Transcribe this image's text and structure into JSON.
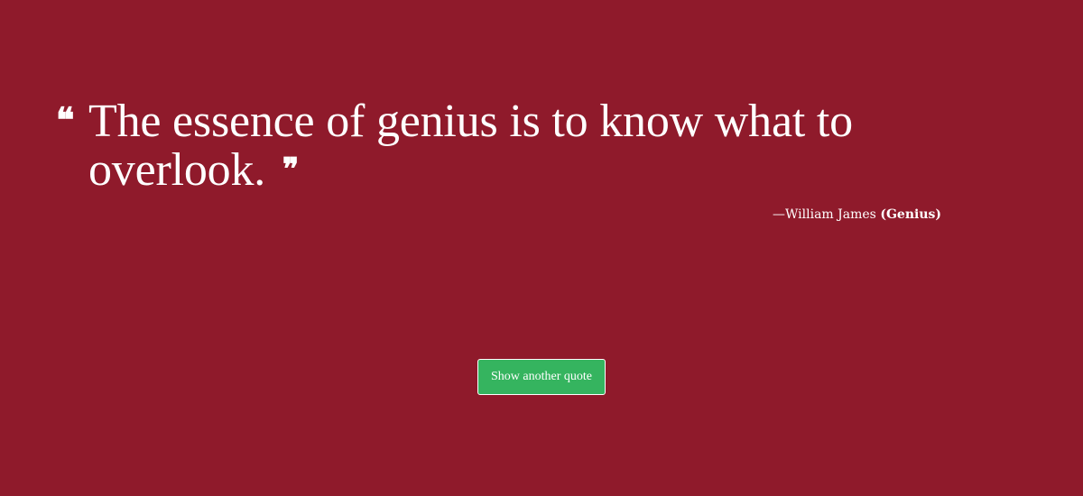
{
  "quote": {
    "open_mark": "❝",
    "text": "The essence of genius is to know what to overlook.",
    "close_mark": "❞"
  },
  "attribution": {
    "author": "—William James",
    "topic": "(Genius)"
  },
  "button": {
    "label": "Show another quote"
  },
  "colors": {
    "background": "#8f1a2b",
    "button": "#35b45f",
    "text": "#ffffff"
  }
}
